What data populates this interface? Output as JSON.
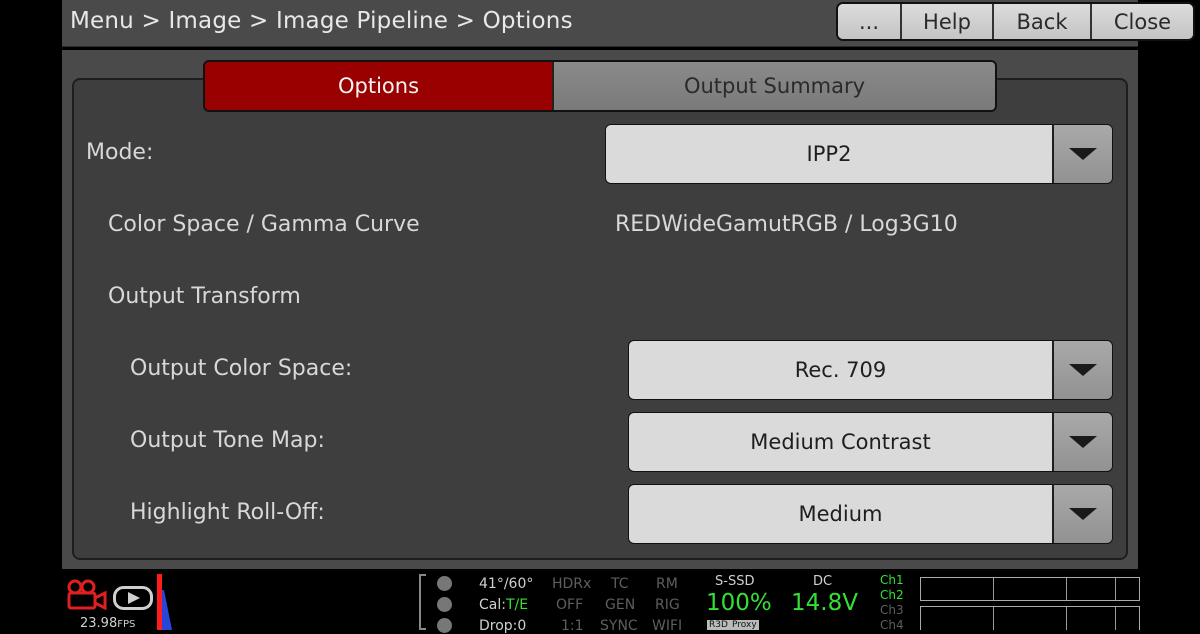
{
  "header": {
    "breadcrumb": "Menu > Image > Image Pipeline > Options",
    "buttons": {
      "more": "...",
      "help": "Help",
      "back": "Back",
      "close": "Close"
    }
  },
  "tabs": [
    {
      "label": "Options",
      "active": true
    },
    {
      "label": "Output Summary",
      "active": false
    }
  ],
  "settings": {
    "mode": {
      "label": "Mode:",
      "value": "IPP2"
    },
    "color_space": {
      "label": "Color Space / Gamma Curve",
      "value": "REDWideGamutRGB / Log3G10"
    },
    "output_transform": {
      "label": "Output Transform"
    },
    "output_color_space": {
      "label": "Output Color Space:",
      "value": "Rec. 709"
    },
    "output_tone_map": {
      "label": "Output Tone Map:",
      "value": "Medium Contrast"
    },
    "highlight_rolloff": {
      "label": "Highlight Roll-Off:",
      "value": "Medium"
    }
  },
  "status": {
    "fps": "23.98",
    "fps_unit": "FPS",
    "temp": "41°/60°",
    "cal_label": "Cal:",
    "cal_value": "T/E",
    "drop": "Drop:0",
    "hdrx": {
      "label": "HDRx",
      "value": "OFF",
      "extra": "1:1"
    },
    "tc": {
      "label": "TC",
      "value": "GEN",
      "extra": "SYNC"
    },
    "rm": {
      "label": "RM",
      "value": "RIG",
      "extra": "WIFI"
    },
    "media": {
      "label": "S-SSD",
      "value": "100%",
      "tag1": "R3D",
      "tag2": "Proxy"
    },
    "power": {
      "label": "DC",
      "value": "14.8V"
    },
    "channels": [
      "Ch1",
      "Ch2",
      "Ch3",
      "Ch4"
    ]
  },
  "colors": {
    "accent_red": "#990000",
    "status_green": "#35e035"
  }
}
